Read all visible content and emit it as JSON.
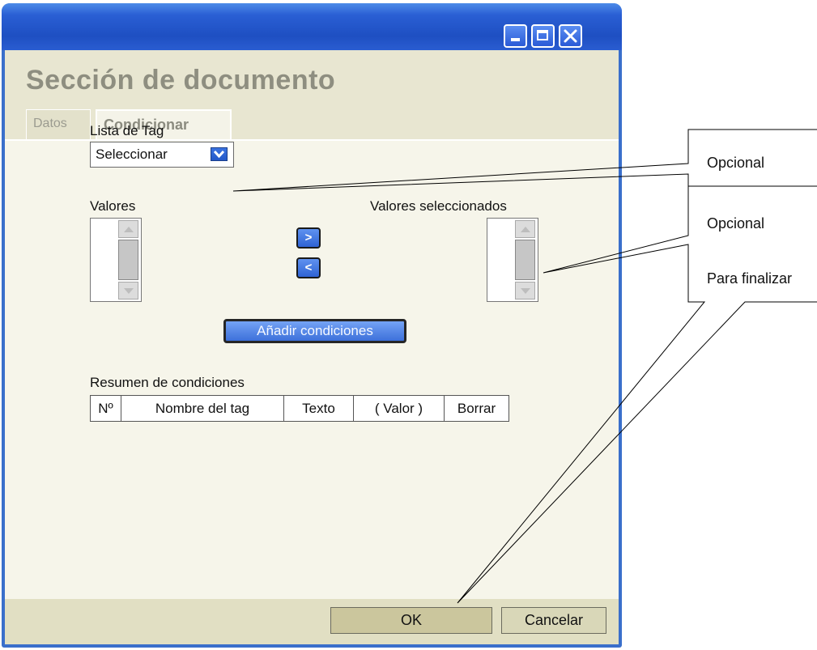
{
  "window": {
    "title": "Sección de documento",
    "controls": [
      "minimize-icon",
      "maximize-icon",
      "close-icon"
    ]
  },
  "tabs": [
    {
      "label": "Datos",
      "active": false
    },
    {
      "label": "Condicionar",
      "active": true
    }
  ],
  "form": {
    "tag_list_label": "Lista de Tag",
    "tag_select_value": "Seleccionar",
    "values_label": "Valores",
    "selected_values_label": "Valores seleccionados",
    "move_right_label": ">",
    "move_left_label": "<",
    "add_conditions_label": "Añadir condiciones",
    "summary_label": "Resumen de condiciones",
    "summary_columns": [
      "Nº",
      "Nombre del tag",
      "Texto",
      "( Valor )",
      "Borrar"
    ]
  },
  "footer": {
    "ok_label": "OK",
    "cancel_label": "Cancelar"
  },
  "annotations": [
    {
      "text": "Opcional"
    },
    {
      "text": "Opcional"
    },
    {
      "text": "Para finalizar"
    }
  ],
  "colors": {
    "titlebar": "#2a5fd4",
    "header_bg": "#e8e6d1",
    "content_bg": "#f6f5ea",
    "footer_bg": "#e1dfc3",
    "button_blue": "#3d70da"
  }
}
